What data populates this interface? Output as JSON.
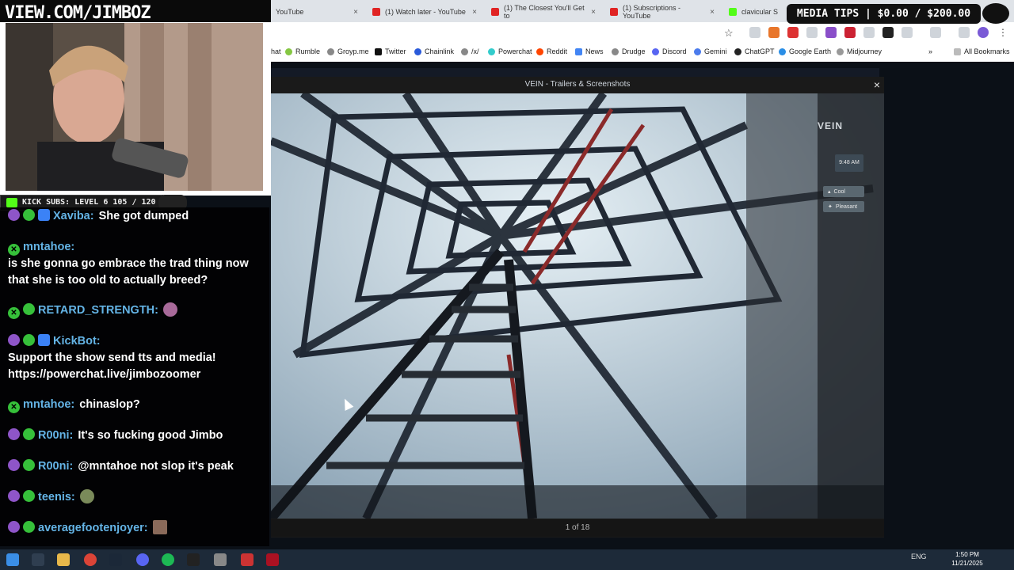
{
  "browser": {
    "tabs": [
      {
        "label": "YouTube",
        "icon": "youtube-icon"
      },
      {
        "label": "(1) Watch later - YouTube",
        "icon": "youtube-icon"
      },
      {
        "label": "(1) The Closest You'll Get to",
        "icon": "youtube-icon"
      },
      {
        "label": "(1) Subscriptions - YouTube",
        "icon": "youtube-icon"
      },
      {
        "label": "clavicular S",
        "icon": "kick-icon"
      }
    ],
    "bookmarks": [
      "hat",
      "Rumble",
      "Groyp.me",
      "Twitter",
      "Chainlink",
      "/x/",
      "Powerchat",
      "Reddit",
      "News",
      "Drudge",
      "Discord",
      "Gemini",
      "ChatGPT",
      "Google Earth",
      "Midjourney"
    ],
    "all_bookmarks": "All Bookmarks"
  },
  "overlay": {
    "banner": "VIEW.COM/JIMBOZ",
    "media_tips": "MEDIA TIPS | $0.00 / $200.00",
    "kick_subs": "KICK SUBS: LEVEL 6 105 / 120"
  },
  "modal": {
    "title": "VEIN - Trailers & Screenshots",
    "close": "×",
    "counter": "1 of 18",
    "ingame": {
      "logo": "VEIN",
      "time": "9:48 AM",
      "chip1": "Cool",
      "chip2": "Pleasant"
    }
  },
  "chat": [
    {
      "user": "Xaviba:",
      "text": "She got dumped",
      "badges": [
        "purple",
        "green",
        "verify"
      ]
    },
    {
      "user": "mntahoe:",
      "text": "is she gonna go embrace the trad thing now that she is too old to actually breed?",
      "badges": [
        "green"
      ]
    },
    {
      "user": "RETARD_STRENGTH:",
      "text": "",
      "badges": [
        "green",
        "green"
      ],
      "emote": true
    },
    {
      "user": "KickBot:",
      "text": "Support the show send tts and media! https://powerchat.live/jimbozoomer",
      "badges": [
        "purple",
        "green",
        "verify"
      ]
    },
    {
      "user": "mntahoe:",
      "text": "chinaslop?",
      "badges": [
        "green"
      ]
    },
    {
      "user": "R00ni:",
      "text": "It's so fucking good Jimbo",
      "badges": [
        "purple",
        "green"
      ]
    },
    {
      "user": "R00ni:",
      "text": "@mntahoe not slop it's peak",
      "badges": [
        "purple",
        "green"
      ]
    },
    {
      "user": "teenis:",
      "text": "",
      "badges": [
        "purple",
        "green"
      ],
      "emote": true
    },
    {
      "user": "averagefootenjoyer:",
      "text": "",
      "badges": [
        "purple",
        "green"
      ],
      "emote": true
    }
  ],
  "taskbar": {
    "lang": "ENG",
    "time": "1:50 PM",
    "date": "11/21/2025"
  }
}
